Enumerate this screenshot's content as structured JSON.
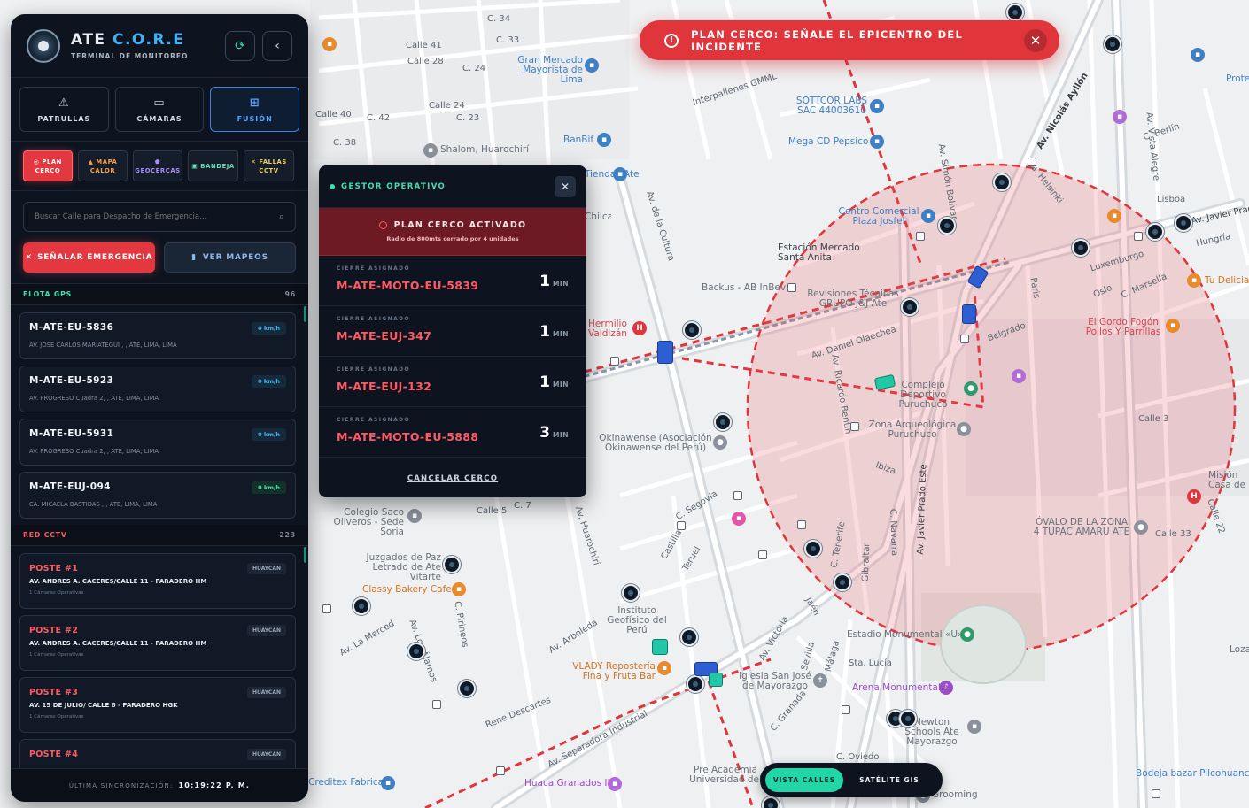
{
  "alert": {
    "text": "PLAN CERCO: SEÑALE EL EPICENTRO DEL INCIDENTE",
    "icon": "alert-circle-icon",
    "close_icon": "close-icon"
  },
  "sidebar": {
    "brand_prefix": "ATE ",
    "brand_accent": "C.O.R.E",
    "subtitle": "TERMINAL DE MONITOREO",
    "header_buttons": [
      "refresh-icon",
      "chevron-left-icon"
    ],
    "tabs": [
      {
        "label": "PATRULLAS",
        "icon": "warning-triangle-icon",
        "glyph": "⚠"
      },
      {
        "label": "CÁMARAS",
        "icon": "video-camera-icon",
        "glyph": "▭"
      },
      {
        "label": "FUSIÓN",
        "icon": "grid-icon",
        "glyph": "⊞",
        "active": true
      }
    ],
    "tools": [
      {
        "label_1": "PLAN",
        "label_2": "CERCO",
        "icon": "target-icon"
      },
      {
        "label_1": "MAPA",
        "label_2": "CALOR",
        "icon": "fire-icon"
      },
      {
        "label_1": "",
        "label_2": "GEOCERCAS",
        "icon": "shield-icon"
      },
      {
        "label_1": "",
        "label_2": "BANDEJA",
        "icon": "inbox-icon"
      },
      {
        "label_1": "FALLAS",
        "label_2": "CCTV",
        "icon": "tools-icon"
      }
    ],
    "search": {
      "placeholder": "Buscar Calle para Despacho de Emergencia...",
      "value": ""
    },
    "emergency_label": "SEÑALAR EMERGENCIA",
    "mapeos_label": "VER MAPEOS",
    "fleet": {
      "title": "FLOTA GPS",
      "count": "96",
      "units": [
        {
          "name": "M-ATE-EU-5836",
          "addr": "AV. JOSE CARLOS MARIATEGUI , , ATE, LIMA, LIMA",
          "speed": "0 km/h"
        },
        {
          "name": "M-ATE-EU-5923",
          "addr": "AV. PROGRESO Cuadra 2, , ATE, LIMA, LIMA",
          "speed": "0 km/h"
        },
        {
          "name": "M-ATE-EU-5931",
          "addr": "AV. PROGRESO Cuadra 2, , ATE, LIMA, LIMA",
          "speed": "0 km/h"
        },
        {
          "name": "M-ATE-EUJ-094",
          "addr": "CA. MICAELA BASTIDAS , , ATE, LIMA, LIMA",
          "speed": "0 km/h"
        }
      ]
    },
    "cctv": {
      "title": "RED CCTV",
      "count": "223",
      "posts": [
        {
          "title": "POSTE #1",
          "addr": "AV. ANDRES A. CACERES/CALLE 11 - PARADERO HM",
          "meta": "1 Cámaras Operativas",
          "zone": "HUAYCAN"
        },
        {
          "title": "POSTE #2",
          "addr": "AV. ANDRES A. CACERES/CALLE 11 - PARADERO HM",
          "meta": "1 Cámaras Operativas",
          "zone": "HUAYCAN"
        },
        {
          "title": "POSTE #3",
          "addr": "AV. 15 DE JULIO/ CALLE 6 - PARADERO HGK",
          "meta": "1 Cámaras Operativas",
          "zone": "HUAYCAN"
        },
        {
          "title": "POSTE #4",
          "addr": "",
          "meta": "",
          "zone": "HUAYCAN"
        }
      ]
    },
    "sync_label": "ÚLTIMA SINCRONIZACIÓN:",
    "sync_time": "10:19:22 P. M."
  },
  "gestor": {
    "title": "GESTOR OPERATIVO",
    "banner_title": "PLAN CERCO ACTIVADO",
    "banner_sub": "Radio de 800mts cerrado por 4 unidades",
    "row_label": "CIERRE ASIGNADO",
    "assignments": [
      {
        "unit": "M-ATE-MOTO-EU-5839",
        "eta": "1",
        "unit_label": "MIN"
      },
      {
        "unit": "M-ATE-EUJ-347",
        "eta": "1",
        "unit_label": "MIN"
      },
      {
        "unit": "M-ATE-EUJ-132",
        "eta": "1",
        "unit_label": "MIN"
      },
      {
        "unit": "M-ATE-MOTO-EU-5888",
        "eta": "3",
        "unit_label": "MIN"
      }
    ],
    "cancel_label": "CANCELAR CERCO"
  },
  "view_toggle": {
    "streets": "VISTA CALLES",
    "satellite": "SATÉLITE GIS"
  },
  "map": {
    "perimeter_color": "#e0353b",
    "street_labels": [
      "Calle 41",
      "Calle 28",
      "C. 24",
      "Calle 24",
      "C. 23",
      "C. 34",
      "C. 33",
      "Calle 40",
      "C. 42",
      "C. 38",
      "Calle 5",
      "C. 7",
      "Av. de la Cultura",
      "Av. Huarochirí",
      "Av. Los Álamos",
      "Av. Separadora Industrial",
      "Av. Nicolás Ayllón",
      "Av. Simón Bolívar",
      "Av. Javier Prado Este",
      "Calle 3",
      "Calle 33",
      "Calle 22",
      "Interpallenes GMML",
      "Av. Daniel Olaechea",
      "Av. Ricardo Bentín",
      "Ca. Helsinki",
      "Av. Arboleda",
      "Av. La Merced",
      "Rene Descartes",
      "C. Segovia",
      "Castilla",
      "Teruel",
      "C. Granada",
      "Av. Vista Alegre",
      "C. Berlín",
      "Belgrado",
      "Ibiza",
      "C. Tenerife",
      "Gibraltar",
      "C. Navarra",
      "Sevilla",
      "Málaga",
      "Jaén",
      "Av. Victoria",
      "C. Pirineos",
      "Sta. Lucía",
      "C. Oviedo",
      "Lisboa",
      "Luxemburgo",
      "C. Marsella",
      "Oslo",
      "Paris",
      "Hungría",
      "Av. Javier Prado E"
    ],
    "pois": [
      {
        "name": "Gran Mercado Mayorista de Lima",
        "color": "blue"
      },
      {
        "name": "SOTTCOR LABS SAC 44003610",
        "color": "blue"
      },
      {
        "name": "Mega CD Pepsico",
        "color": "blue"
      },
      {
        "name": "Shalom, Huarochirí",
        "color": "gray"
      },
      {
        "name": "BanBif",
        "color": "blue"
      },
      {
        "name": "Centro Comercial Plaza Josfel",
        "color": "blue"
      },
      {
        "name": "Estación Mercado Santa Anita",
        "color": "dark"
      },
      {
        "name": "Backus - AB InBev",
        "color": "gray"
      },
      {
        "name": "Revisiones Técnicas GRUPO J&J Ate",
        "color": "gray"
      },
      {
        "name": "Hermilio Valdizán",
        "color": "red"
      },
      {
        "name": "Complejo Deportivo Puruchuco",
        "color": "gray"
      },
      {
        "name": "Zona Arqueológica Puruchuco",
        "color": "gray"
      },
      {
        "name": "Okinawense (Asociación Okinawense del Perú)",
        "color": "gray"
      },
      {
        "name": "Colegio Saco Oliveros - Sede Soria",
        "color": "gray"
      },
      {
        "name": "Juzgados de Paz Letrado de Ate Vitarte",
        "color": "gray"
      },
      {
        "name": "Classy Bakery Cafe",
        "color": "orange"
      },
      {
        "name": "Instituto Geofísico del Perú",
        "color": "gray"
      },
      {
        "name": "VLADY Repostería Fina y Fruta Bar",
        "color": "orange"
      },
      {
        "name": "Iglesia San José de Mayorazgo",
        "color": "gray"
      },
      {
        "name": "Arena Monumental",
        "color": "purple"
      },
      {
        "name": "Estadio Monumental «U»",
        "color": "gray"
      },
      {
        "name": "Newton Schools Ate Mayorazgo",
        "color": "gray"
      },
      {
        "name": "Pre Academia Universidad del",
        "color": "gray"
      },
      {
        "name": "Creditex Fabrica",
        "color": "blue"
      },
      {
        "name": "Huaca Granados II",
        "color": "purple"
      },
      {
        "name": "El Gordo Fogón Pollos Y Parrillas",
        "color": "red"
      },
      {
        "name": "Tu Delicia",
        "color": "orange"
      },
      {
        "name": "ÓVALO DE LA ZONA 4 TUPAC AMARU ATE",
        "color": "gray"
      },
      {
        "name": "Bodeja bazar Pilcohuanca",
        "color": "blue"
      },
      {
        "name": "Misión Casa de",
        "color": "gray"
      },
      {
        "name": "Tiendas Ate",
        "color": "blue"
      },
      {
        "name": "Grooming",
        "color": "gray"
      },
      {
        "name": "Loza",
        "color": "gray"
      },
      {
        "name": "Protección para",
        "color": "blue"
      },
      {
        "name": "Chilcayo",
        "color": "gray"
      }
    ]
  }
}
